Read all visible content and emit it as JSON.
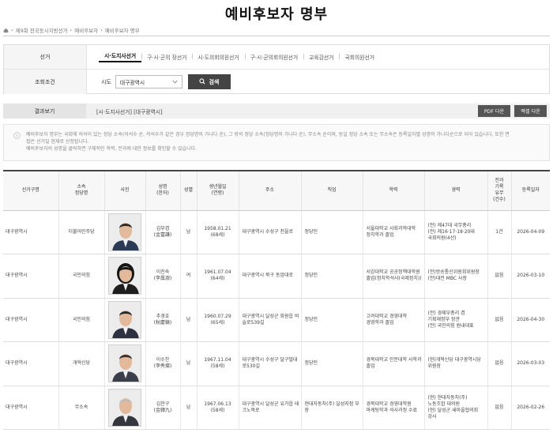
{
  "page_title": "예비후보자 명부",
  "breadcrumb": [
    "제9회 전국동시지방선거",
    "예비후보자",
    "예비후보자 명부"
  ],
  "search": {
    "election_label": "선거",
    "tabs": [
      "시·도지사선거",
      "구·시·군의 장선거",
      "시·도의회의원선거",
      "구·시·군의회의원선거",
      "교육감선거",
      "국회의원선거"
    ],
    "active_tab": 0,
    "condition_label": "조회조건",
    "sido_label": "시도",
    "sido_value": "대구광역시",
    "search_button": "검색"
  },
  "result": {
    "label": "결과보기",
    "text": "[시·도지사선거] [대구광역시]",
    "pdf_button": "PDF 다운",
    "excel_button": "엑셀 다운"
  },
  "notice": [
    "예비후보자 명부는 국회에 의석이 있는 정당 소속(의석수 순, 의석수가 같은 경우 정당명의 가나다 순), 그 밖의 정당 소속(정당명의 가나다 순), 무소속 순이며, 동일 정당 소속 또는 무소속은 등록일자별 성명의 가나다순으로 되어 있습니다. 또한 면",
    "접은 선거일 현재로 산정됩니다.",
    "예비후보자의 성명을 클릭하면 구체적인 학력, 전과에 대한 정보를 확인할 수 있습니다."
  ],
  "table": {
    "headers": [
      "선거구명",
      "소속\n정당명",
      "사진",
      "성명\n(한자)",
      "성별",
      "생년월일\n(연령)",
      "주소",
      "직업",
      "학력",
      "경력",
      "전과\n기록\n유무\n(건수)",
      "등록일자"
    ],
    "rows": [
      {
        "district": "대구광역시",
        "party": "더불어민주당",
        "name": "김부겸",
        "hanja": "(金富謙)",
        "gender": "남",
        "birth": "1958.01.21",
        "age": "(68세)",
        "address": "대구광역시 수성구 천을로",
        "job": "정당인",
        "edu": [
          "서울대학교 사회과학대학",
          "정치학과 졸업"
        ],
        "career": [
          "(전) 제47대 국무총리",
          "(전) 제16·17·18·20대",
          "국회의원(4선)"
        ],
        "record": "1건",
        "date": "2026-04-09"
      },
      {
        "district": "대구광역시",
        "party": "국민의힘",
        "name": "이진숙",
        "hanja": "(李眞淑)",
        "gender": "여",
        "birth": "1961.07.04",
        "age": "(64세)",
        "address": "대구광역시 북구 동암대로",
        "job": "정당인",
        "edu": [
          "서강대학교 공공정책대학원",
          "졸업(정치학석사(국제정치))"
        ],
        "career": [
          "(전)방송통신위원회위원장",
          "(전)대전 MBC 사장"
        ],
        "record": "없음",
        "date": "2026-03-10"
      },
      {
        "district": "대구광역시",
        "party": "국민의힘",
        "name": "추경호",
        "hanja": "(秋慶鎬)",
        "gender": "남",
        "birth": "1960.07.29",
        "age": "(65세)",
        "address": "대구광역시 달성군 화원읍 비슬로539길",
        "job": "정당인",
        "edu": [
          "고려대학교 경영대학",
          "경영학과 졸업"
        ],
        "career": [
          "(전) 경제부총리 겸",
          "기획재정부 장관",
          "(전) 국민의힘 원내대표"
        ],
        "record": "없음",
        "date": "2026-04-30"
      },
      {
        "district": "대구광역시",
        "party": "개혁신당",
        "name": "이수찬",
        "hanja": "(李秀燦)",
        "gender": "남",
        "birth": "1967.11.04",
        "age": "(58세)",
        "address": "대구광역시 수성구 달구벌대로530길",
        "job": "정당인",
        "edu": [
          "경북대학교 인문대학 사학과",
          "졸업"
        ],
        "career": [
          "(현)개혁신당 대구광역시당",
          "위원장"
        ],
        "record": "없음",
        "date": "2026-03-03"
      },
      {
        "district": "대구광역시",
        "party": "무소속",
        "name": "김한구",
        "hanja": "(金韓九)",
        "gender": "남",
        "birth": "1967.06.13",
        "age": "(58세)",
        "address": "대구광역시 달성군 유가읍 테크노북로",
        "job": "현대자동차(주) 달성지점 부장",
        "edu": [
          "경북대학교 경영대학원",
          "마케팅학과 석사과정 수료"
        ],
        "career": [
          "(현) 현대자동차(주)",
          "노동조합 대의원",
          "(현) 달성군 새마을협의회",
          "강사"
        ],
        "record": "없음",
        "date": "2026-02-26"
      }
    ]
  },
  "colors": {
    "dark_button": "#444444",
    "download_button": "#555555",
    "header_bg": "#f7f7f7"
  },
  "icons": [
    "home-icon",
    "chevron-down-icon",
    "search-icon",
    "info-circle-icon"
  ]
}
